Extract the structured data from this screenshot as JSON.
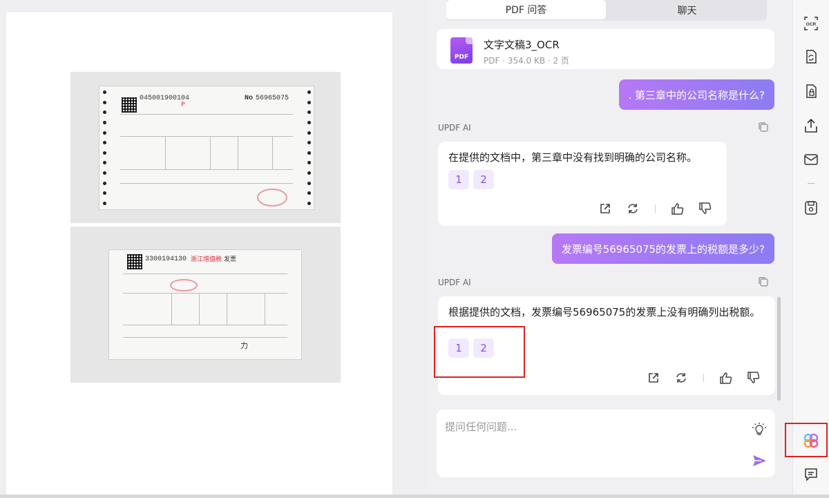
{
  "viewer": {
    "invoice1": {
      "code": "045001900104",
      "number_prefix": "No",
      "number": "56965075",
      "mark": "P"
    },
    "invoice2": {
      "code": "3300194130",
      "title": "浙江增值税",
      "title_suffix": "发票",
      "char": "力"
    }
  },
  "tabs": [
    {
      "label": "PDF 问答",
      "active": true
    },
    {
      "label": "聊天",
      "active": false
    }
  ],
  "file": {
    "badge": "PDF",
    "name": "文字文稿3_OCR",
    "meta": "PDF · 354.0 KB · 2 页"
  },
  "messages": [
    {
      "role": "user",
      "text": ". 第三章中的公司名称是什么?"
    },
    {
      "role": "ai",
      "label": "UPDF AI",
      "text": "在提供的文档中，第三章中没有找到明确的公司名称。",
      "refs": [
        "1",
        "2"
      ]
    },
    {
      "role": "user",
      "text": "发票编号56965075的发票上的税额是多少?"
    },
    {
      "role": "ai",
      "label": "UPDF AI",
      "text": "根据提供的文档，发票编号56965075的发票上没有明确列出税额。",
      "refs": [
        "1",
        "2"
      ]
    }
  ],
  "input": {
    "placeholder": "提问任何问题..."
  },
  "colors": {
    "accent": "#8c7cf2",
    "accent_start": "#b678f5",
    "highlight_box": "#e0201e"
  },
  "toolbar_icons": [
    "ocr-icon",
    "convert-icon",
    "protect-icon",
    "share-icon",
    "mail-icon",
    "save-icon",
    "ai-assistant-icon",
    "comment-icon"
  ]
}
